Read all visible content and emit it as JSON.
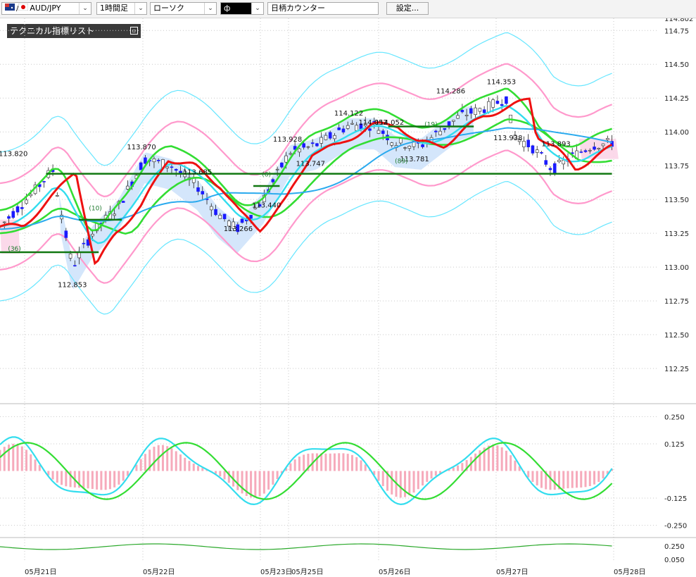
{
  "toolbar": {
    "pair": "AUD/JPY",
    "timeframe": "1時間足",
    "chart_type": "ローソク",
    "counter_placeholder": "日柄カウンター",
    "settings_label": "設定...",
    "style_glyph": "ф"
  },
  "indicator_panel": {
    "title": "テクニカル指標リスト"
  },
  "colors": {
    "up_candle": "#ffffff",
    "down_candle": "#1a1aff",
    "bb_outer": "#66e6ff",
    "bb_inner": "#ff99cc",
    "ma_green": "#33dd33",
    "ma_cyan": "#33ddee",
    "price_line": "#ee1111",
    "hline": "#117711",
    "cloud_blue": "#cfe3fb",
    "cloud_pink": "#fbd5e8"
  },
  "chart_data": {
    "type": "line",
    "main_axis": {
      "ylim": [
        112.0,
        114.84
      ],
      "ticks": [
        "114.75",
        "114.50",
        "114.25",
        "114.00",
        "113.75",
        "113.50",
        "113.25",
        "113.00",
        "112.75",
        "112.50",
        "112.25"
      ],
      "top_partial_label": "114.802"
    },
    "sub_axis": {
      "ylim": [
        -0.3,
        0.3
      ],
      "ticks": [
        "0.250",
        "0.125",
        "-0.125",
        "-0.250"
      ]
    },
    "volume_axis": {
      "ticks": [
        "0.250",
        "0.050"
      ]
    },
    "x_labels": [
      "05月21日",
      "05月22日",
      "05月23日",
      "05月25日",
      "05月26日",
      "05月27日",
      "05月28日"
    ],
    "annotations": [
      {
        "text": "113.820",
        "x": 0.02,
        "y": 113.82
      },
      {
        "text": "112.853",
        "x": 0.11,
        "y": 112.853
      },
      {
        "text": "113.870",
        "x": 0.215,
        "y": 113.87
      },
      {
        "text": "113.685",
        "x": 0.3,
        "y": 113.685
      },
      {
        "text": "113.266",
        "x": 0.362,
        "y": 113.266
      },
      {
        "text": "113.440",
        "x": 0.405,
        "y": 113.44
      },
      {
        "text": "113.747",
        "x": 0.472,
        "y": 113.747
      },
      {
        "text": "113.928",
        "x": 0.437,
        "y": 113.928
      },
      {
        "text": "114.122",
        "x": 0.53,
        "y": 114.122
      },
      {
        "text": "114.052",
        "x": 0.567,
        "y": 114.052
      },
      {
        "text": "114.052",
        "x": 0.592,
        "y": 114.052
      },
      {
        "text": "113.781",
        "x": 0.63,
        "y": 113.781
      },
      {
        "text": "114.286",
        "x": 0.685,
        "y": 114.286
      },
      {
        "text": "114.353",
        "x": 0.762,
        "y": 114.353
      },
      {
        "text": "113.938",
        "x": 0.772,
        "y": 113.938
      },
      {
        "text": "113.893",
        "x": 0.845,
        "y": 113.893
      }
    ],
    "counts": [
      {
        "text": "(36)",
        "x": 0.022,
        "y": 113.12
      },
      {
        "text": "(10)",
        "x": 0.145,
        "y": 113.42
      },
      {
        "text": "(6)",
        "x": 0.405,
        "y": 113.67
      },
      {
        "text": "(19)",
        "x": 0.655,
        "y": 114.04
      },
      {
        "text": "(89)",
        "x": 0.61,
        "y": 113.77
      }
    ],
    "horizontal_lines": [
      {
        "x0": 0.0,
        "x1": 0.15,
        "y": 113.11
      },
      {
        "x0": 0.12,
        "x1": 0.185,
        "y": 113.35
      },
      {
        "x0": 0.07,
        "x1": 0.93,
        "y": 113.69
      },
      {
        "x0": 0.385,
        "x1": 0.425,
        "y": 113.6
      },
      {
        "x0": 0.59,
        "x1": 0.72,
        "y": 114.04
      }
    ]
  }
}
